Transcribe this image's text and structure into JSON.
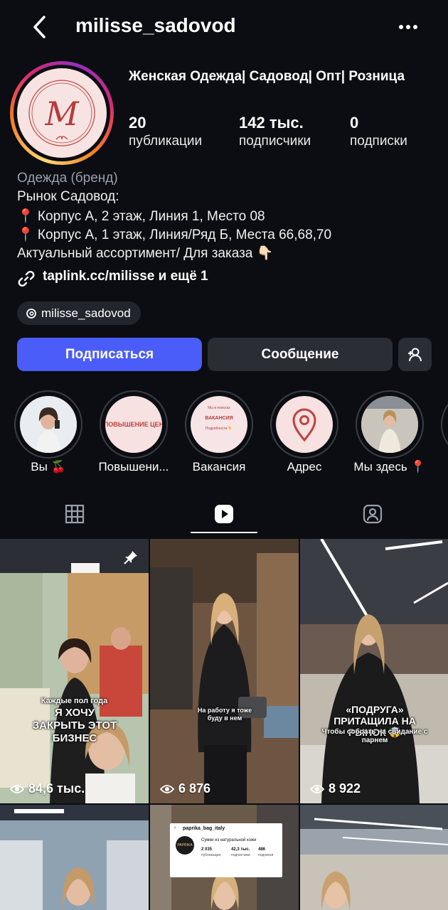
{
  "header": {
    "username": "milisse_sadovod"
  },
  "profile": {
    "display_name": "Женская Одежда| Садовод| Опт| Розница",
    "avatar_letter": "M",
    "stats": [
      {
        "value": "20",
        "label": "публикации"
      },
      {
        "value": "142 тыс.",
        "label": "подписчики"
      },
      {
        "value": "0",
        "label": "подписки"
      }
    ],
    "category": "Одежда (бренд)",
    "bio": [
      "Рынок Садовод:",
      "📍 Корпус А, 2 этаж, Линия 1, Место 08",
      "📍 Корпус А, 1 этаж, Линия/Ряд Б, Места 66,68,70",
      "Актуальный ассортимент/ Для заказа 👇🏻"
    ],
    "link": "taplink.cc/milisse и ещё 1",
    "threads_handle": "milisse_sadovod"
  },
  "actions": {
    "follow": "Подписаться",
    "message": "Сообщение"
  },
  "highlights": [
    {
      "label": "Вы 🍒"
    },
    {
      "label": "Повышени...",
      "thumb_text": "ПОВЫШЕНИЕ ЦЕН"
    },
    {
      "label": "Вакансия",
      "thumb_lines": [
        "Мы в поисках",
        "ВАКАНСИЯ",
        "Подробности 👇"
      ]
    },
    {
      "label": "Адрес"
    },
    {
      "label": "Мы здесь 📍"
    }
  ],
  "tabs": [
    "grid",
    "reels",
    "tagged"
  ],
  "reels": [
    {
      "views": "84,6 тыс.",
      "caption_small": "Каждые пол года",
      "caption_big": "Я ХОЧУ ЗАКРЫТЬ ЭТОТ БИЗНЕС",
      "pinned": true
    },
    {
      "views": "6 876",
      "caption_small": "На работу я тоже буду в нем"
    },
    {
      "views": "8 922",
      "caption_big": "«ПОДРУГА» ПРИТАЩИЛА НА РЫНОК 🤯",
      "caption_small": "Чтобы собрать на свидание с парнем"
    }
  ],
  "second_row": {
    "embedded_profile": {
      "handle": "paprika_bag_italy",
      "desc": "Сумки из натуральной кожи",
      "logo": "PAPRIKA",
      "stats": [
        {
          "value": "2 035",
          "label": "публикации"
        },
        {
          "value": "42,3 тыс.",
          "label": "подписчики"
        },
        {
          "value": "486",
          "label": "подписки"
        }
      ]
    }
  },
  "colors": {
    "background": "#0b0d12",
    "follow_button": "#4a5df9",
    "secondary_button": "#2a2d34"
  }
}
